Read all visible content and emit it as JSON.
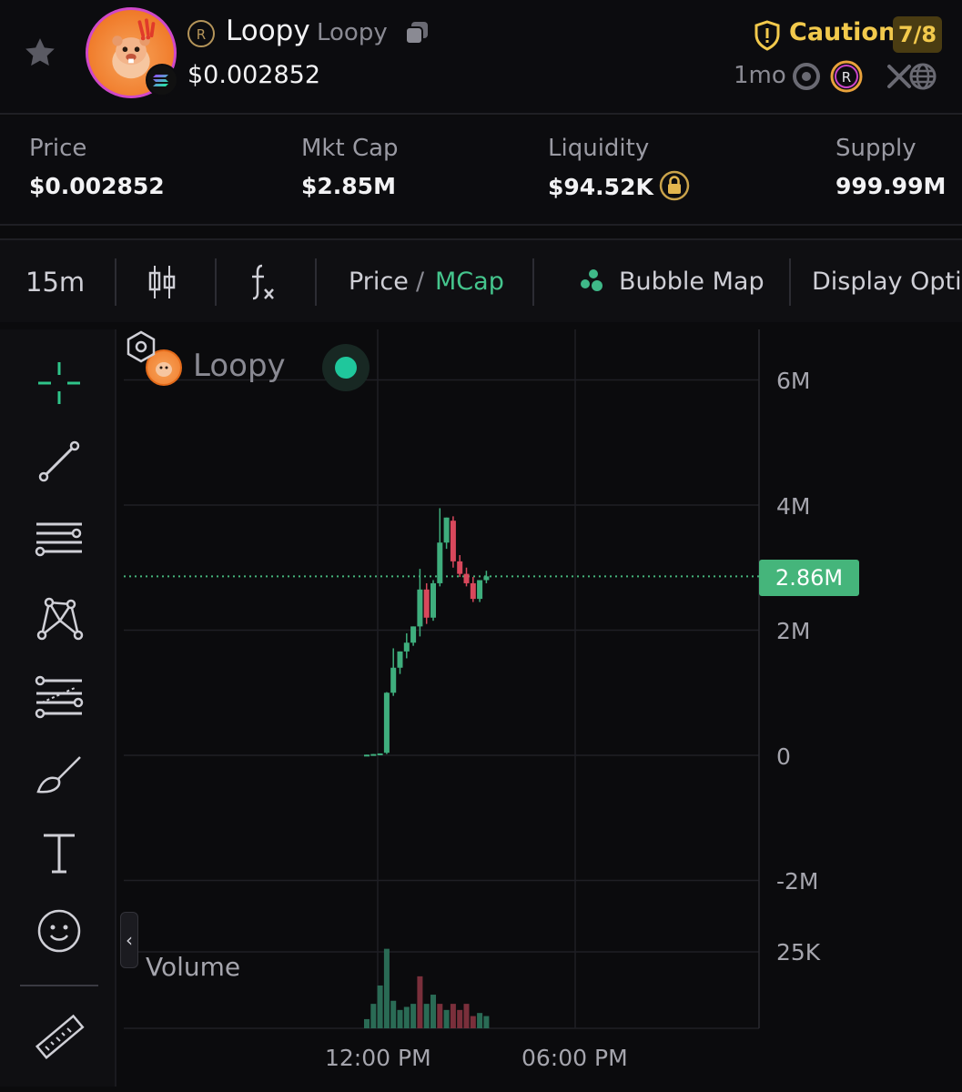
{
  "header": {
    "token_name": "Loopy",
    "token_symbol": "Loopy",
    "price": "$0.002852",
    "caution_label": "Caution",
    "caution_score": "7/8",
    "age": "1mo",
    "icons": [
      "star-icon",
      "copy-icon",
      "shield-icon",
      "radar-icon",
      "raydium-icon",
      "x-icon",
      "globe-icon",
      "solana-icon"
    ]
  },
  "stats": {
    "price_label": "Price",
    "price_value": "$0.002852",
    "mktcap_label": "Mkt Cap",
    "mktcap_value": "$2.85M",
    "liquidity_label": "Liquidity",
    "liquidity_value": "$94.52K",
    "supply_label": "Supply",
    "supply_value": "999.99M"
  },
  "toolbar": {
    "interval": "15m",
    "price_label": "Price",
    "separator": "/",
    "mcap_label": "MCap",
    "bubble_map": "Bubble Map",
    "display_options": "Display Options"
  },
  "chart": {
    "legend_name": "Loopy",
    "current_tag": "2.86M",
    "volume_label": "Volume",
    "colors": {
      "up": "#3fae7d",
      "down": "#d9485c",
      "tag": "#45b57b"
    }
  },
  "chart_data": {
    "type": "candlestick",
    "series_label": "Loopy",
    "y_unit": "market cap (USD)",
    "y_ticks": [
      "6M",
      "4M",
      "2M",
      "0",
      "-2M"
    ],
    "y_range": [
      -2000000,
      6000000
    ],
    "x_ticks": [
      "12:00 PM",
      "06:00 PM"
    ],
    "current_value": 2860000,
    "candles": [
      {
        "o": 0.0,
        "h": 0.01,
        "l": 0.0,
        "c": 0.01
      },
      {
        "o": 0.01,
        "h": 0.02,
        "l": 0.01,
        "c": 0.02
      },
      {
        "o": 0.02,
        "h": 0.03,
        "l": 0.02,
        "c": 0.03
      },
      {
        "o": 0.04,
        "h": 1.01,
        "l": 0.02,
        "c": 1.0
      },
      {
        "o": 1.0,
        "h": 1.71,
        "l": 0.95,
        "c": 1.4
      },
      {
        "o": 1.4,
        "h": 1.66,
        "l": 1.3,
        "c": 1.66
      },
      {
        "o": 1.66,
        "h": 1.95,
        "l": 1.55,
        "c": 1.8
      },
      {
        "o": 1.8,
        "h": 2.06,
        "l": 1.75,
        "c": 2.06
      },
      {
        "o": 2.06,
        "h": 2.98,
        "l": 1.9,
        "c": 2.65
      },
      {
        "o": 2.65,
        "h": 2.75,
        "l": 2.1,
        "c": 2.2
      },
      {
        "o": 2.2,
        "h": 2.8,
        "l": 2.15,
        "c": 2.75
      },
      {
        "o": 2.75,
        "h": 3.95,
        "l": 2.7,
        "c": 3.4
      },
      {
        "o": 3.4,
        "h": 3.8,
        "l": 3.3,
        "c": 3.8
      },
      {
        "o": 3.75,
        "h": 3.82,
        "l": 3.0,
        "c": 3.1
      },
      {
        "o": 3.1,
        "h": 3.2,
        "l": 2.85,
        "c": 2.9
      },
      {
        "o": 2.9,
        "h": 3.0,
        "l": 2.7,
        "c": 2.75
      },
      {
        "o": 2.75,
        "h": 2.85,
        "l": 2.45,
        "c": 2.5
      },
      {
        "o": 2.5,
        "h": 2.8,
        "l": 2.45,
        "c": 2.8
      },
      {
        "o": 2.8,
        "h": 2.95,
        "l": 2.75,
        "c": 2.86
      }
    ],
    "volume_ticks": [
      "25K"
    ],
    "volumes": [
      {
        "v": 3000,
        "up": true
      },
      {
        "v": 8000,
        "up": true
      },
      {
        "v": 14000,
        "up": true
      },
      {
        "v": 26000,
        "up": true
      },
      {
        "v": 9000,
        "up": true
      },
      {
        "v": 6000,
        "up": true
      },
      {
        "v": 7000,
        "up": true
      },
      {
        "v": 8000,
        "up": true
      },
      {
        "v": 17000,
        "down": true
      },
      {
        "v": 8000,
        "up": true
      },
      {
        "v": 11000,
        "up": true
      },
      {
        "v": 8000,
        "down": true
      },
      {
        "v": 6000,
        "up": true
      },
      {
        "v": 8000,
        "down": true
      },
      {
        "v": 6000,
        "down": true
      },
      {
        "v": 8000,
        "down": true
      },
      {
        "v": 4000,
        "down": true
      },
      {
        "v": 5000,
        "up": true
      },
      {
        "v": 4000,
        "up": true
      }
    ]
  }
}
